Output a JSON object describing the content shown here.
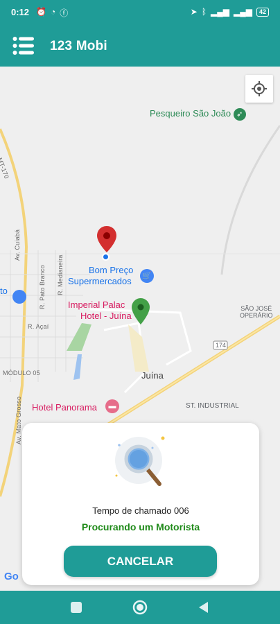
{
  "status_bar": {
    "time": "0:12",
    "left_icons": [
      "alarm-icon",
      "messenger-icon",
      "facebook-icon"
    ],
    "right_icons": [
      "location-arrow-icon",
      "bluetooth-icon",
      "signal-icon",
      "4g-signal-icon"
    ],
    "battery": "42"
  },
  "app_bar": {
    "title": "123 Mobi",
    "menu_icon": "hamburger-menu-icon"
  },
  "map": {
    "pois": {
      "pesqueiro": "Pesqueiro São João",
      "bom_preco_line1": "Bom Preço",
      "bom_preco_line2": "Supermercados",
      "imperial_line1": "Imperial Palac",
      "imperial_line2": "Hotel - Juína",
      "hotel_panorama": "Hotel Panorama",
      "left_poi": "to"
    },
    "streets": {
      "av_cuiaba": "Av. Cuiabá",
      "r_pato_branco": "R. Pato Branco",
      "r_medianeira": "R. Medianeira",
      "r_acai": "R. Açaí",
      "modulo_05": "MÓDULO 05",
      "av_mato_grosso": "Av. Mato Grosso",
      "sao_jose_line1": "SÃO JOSÉ",
      "sao_jose_line2": "OPERÁRIO",
      "st_industrial": "ST. INDUSTRIAL",
      "route_174": "174",
      "left_road": "MT-170"
    },
    "city": "Juína",
    "google_logo": "Go",
    "markers": {
      "red_pin_color": "#d32f2f",
      "green_pin_color": "#43a047",
      "blue_dot_color": "#1a73e8"
    }
  },
  "search_card": {
    "call_time": "Tempo de chamado 006",
    "status": "Procurando um Motorista",
    "cancel_label": "CANCELAR"
  },
  "colors": {
    "primary": "#1f9c97",
    "status_green": "#1f8a19"
  }
}
